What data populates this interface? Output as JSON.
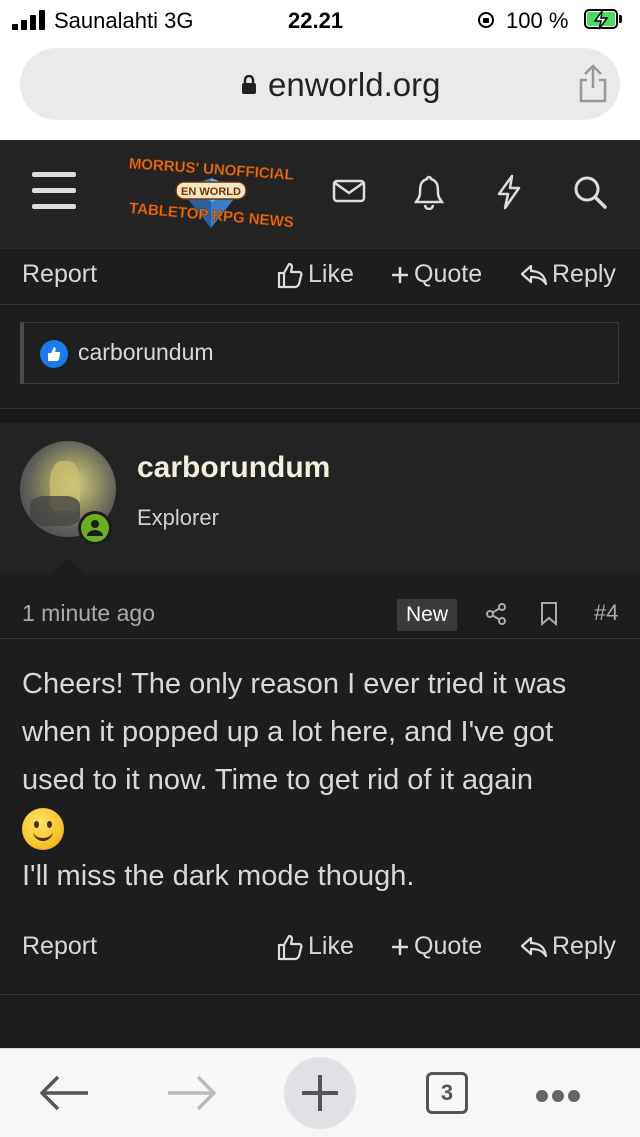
{
  "status_bar": {
    "carrier": "Saunalahti  3G",
    "time": "22.21",
    "battery": "100 %"
  },
  "browser": {
    "url": "enworld.org",
    "tab_count": "3"
  },
  "site_header": {
    "logo": {
      "line1": "MORRUS' UNOFFICIAL",
      "badge": "EN WORLD",
      "line2": "TABLETOP RPG NEWS"
    },
    "icons": [
      "menu-icon",
      "mail-icon",
      "bell-icon",
      "lightning-icon",
      "search-icon"
    ]
  },
  "previous_post": {
    "actions": {
      "report": "Report",
      "like": "Like",
      "quote": "Quote",
      "reply": "Reply"
    },
    "reaction_user": "carborundum"
  },
  "post": {
    "username": "carborundum",
    "user_title": "Explorer",
    "timestamp": "1 minute ago",
    "badge": "New",
    "post_number": "#4",
    "body_line1": "Cheers! The only reason I ever tried it was when it popped up a lot here, and I've got used to it now. Time to get rid of it again",
    "body_line2": "I'll miss the dark mode though.",
    "actions": {
      "report": "Report",
      "like": "Like",
      "quote": "Quote",
      "reply": "Reply"
    }
  },
  "colors": {
    "background": "#1d1d1d",
    "accent_blue": "#1b7be8",
    "online_green": "#6aaf24",
    "logo_orange": "#e8721c"
  }
}
